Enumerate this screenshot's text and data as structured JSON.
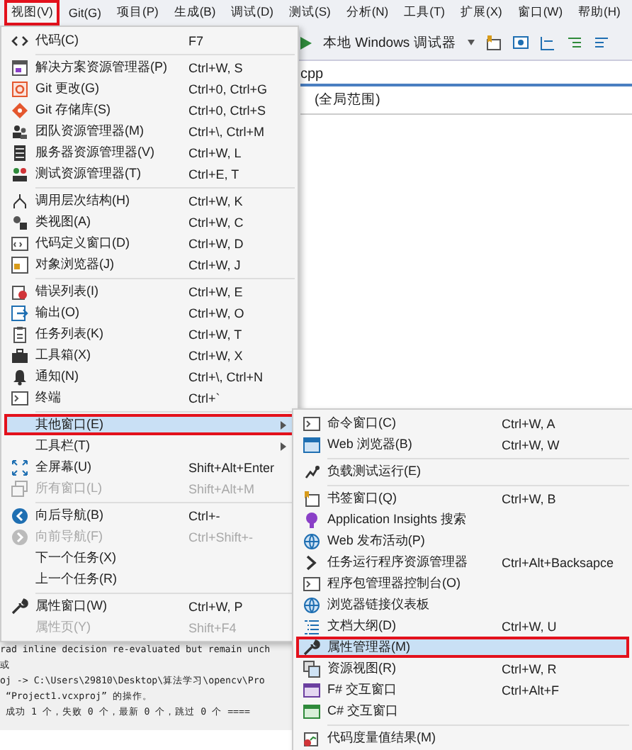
{
  "menu_bar": [
    {
      "label": "视图(V)",
      "selected": true
    },
    {
      "label": "Git(G)",
      "selected": false
    },
    {
      "label": "项目(P)",
      "selected": false
    },
    {
      "label": "生成(B)",
      "selected": false
    },
    {
      "label": "调试(D)",
      "selected": false
    },
    {
      "label": "测试(S)",
      "selected": false
    },
    {
      "label": "分析(N)",
      "selected": false
    },
    {
      "label": "工具(T)",
      "selected": false
    },
    {
      "label": "扩展(X)",
      "selected": false
    },
    {
      "label": "窗口(W)",
      "selected": false
    },
    {
      "label": "帮助(H)",
      "selected": false
    }
  ],
  "toolbar": {
    "debugger": "本地 Windows 调试器"
  },
  "editor": {
    "file_tab": "cpp",
    "scope": "(全局范围)"
  },
  "output": {
    "lines": [
      "rad inline decision re-evaluated but remain unch",
      "或",
      "oj -> C:\\Users\\29810\\Desktop\\算法学习\\opencv\\Pro",
      " “Project1.vcxproj” 的操作。",
      " 成功 1 个，失败 0 个，最新 0 个，跳过 0 个 ===="
    ]
  },
  "view_menu": {
    "groups": [
      [
        {
          "kind": "code",
          "label": "代码(C)",
          "shortcut": "F7",
          "disabled": false,
          "selected": false,
          "submenu": false
        }
      ],
      [
        {
          "kind": "solution",
          "label": "解决方案资源管理器(P)",
          "shortcut": "Ctrl+W, S",
          "disabled": false,
          "selected": false,
          "submenu": false
        },
        {
          "kind": "git-change",
          "label": "Git 更改(G)",
          "shortcut": "Ctrl+0, Ctrl+G",
          "disabled": false,
          "selected": false,
          "submenu": false
        },
        {
          "kind": "git-repo",
          "label": "Git 存储库(S)",
          "shortcut": "Ctrl+0, Ctrl+S",
          "disabled": false,
          "selected": false,
          "submenu": false
        },
        {
          "kind": "team",
          "label": "团队资源管理器(M)",
          "shortcut": "Ctrl+\\, Ctrl+M",
          "disabled": false,
          "selected": false,
          "submenu": false
        },
        {
          "kind": "server",
          "label": "服务器资源管理器(V)",
          "shortcut": "Ctrl+W, L",
          "disabled": false,
          "selected": false,
          "submenu": false
        },
        {
          "kind": "test",
          "label": "测试资源管理器(T)",
          "shortcut": "Ctrl+E, T",
          "disabled": false,
          "selected": false,
          "submenu": false
        }
      ],
      [
        {
          "kind": "hierarchy",
          "label": "调用层次结构(H)",
          "shortcut": "Ctrl+W, K",
          "disabled": false,
          "selected": false,
          "submenu": false
        },
        {
          "kind": "class",
          "label": "类视图(A)",
          "shortcut": "Ctrl+W, C",
          "disabled": false,
          "selected": false,
          "submenu": false
        },
        {
          "kind": "code-window",
          "label": "代码定义窗口(D)",
          "shortcut": "Ctrl+W, D",
          "disabled": false,
          "selected": false,
          "submenu": false
        },
        {
          "kind": "object-browser",
          "label": "对象浏览器(J)",
          "shortcut": "Ctrl+W, J",
          "disabled": false,
          "selected": false,
          "submenu": false
        }
      ],
      [
        {
          "kind": "error-list",
          "label": "错误列表(I)",
          "shortcut": "Ctrl+W, E",
          "disabled": false,
          "selected": false,
          "submenu": false
        },
        {
          "kind": "output",
          "label": "输出(O)",
          "shortcut": "Ctrl+W, O",
          "disabled": false,
          "selected": false,
          "submenu": false
        },
        {
          "kind": "task-list",
          "label": "任务列表(K)",
          "shortcut": "Ctrl+W, T",
          "disabled": false,
          "selected": false,
          "submenu": false
        },
        {
          "kind": "toolbox",
          "label": "工具箱(X)",
          "shortcut": "Ctrl+W, X",
          "disabled": false,
          "selected": false,
          "submenu": false
        },
        {
          "kind": "bell",
          "label": "通知(N)",
          "shortcut": "Ctrl+\\, Ctrl+N",
          "disabled": false,
          "selected": false,
          "submenu": false
        },
        {
          "kind": "terminal",
          "label": "终端",
          "shortcut": "Ctrl+`",
          "disabled": false,
          "selected": false,
          "submenu": false
        }
      ],
      [
        {
          "label": "其他窗口(E)",
          "disabled": false,
          "selected": true,
          "submenu": true
        },
        {
          "label": "工具栏(T)",
          "disabled": false,
          "selected": false,
          "submenu": true
        },
        {
          "kind": "fullscreen",
          "label": "全屏幕(U)",
          "shortcut": "Shift+Alt+Enter",
          "disabled": false,
          "selected": false,
          "submenu": false
        },
        {
          "kind": "windows",
          "label": "所有窗口(L)",
          "shortcut": "Shift+Alt+M",
          "disabled": true,
          "selected": false,
          "submenu": false
        }
      ],
      [
        {
          "kind": "back",
          "label": "向后导航(B)",
          "shortcut": "Ctrl+-",
          "disabled": false,
          "selected": false,
          "submenu": false
        },
        {
          "kind": "forward",
          "label": "向前导航(F)",
          "shortcut": "Ctrl+Shift+-",
          "disabled": true,
          "selected": false,
          "submenu": false
        },
        {
          "label": "下一个任务(X)",
          "disabled": false,
          "selected": false,
          "submenu": false
        },
        {
          "label": "上一个任务(R)",
          "disabled": false,
          "selected": false,
          "submenu": false
        }
      ],
      [
        {
          "kind": "wrench",
          "label": "属性窗口(W)",
          "shortcut": "Ctrl+W, P",
          "disabled": false,
          "selected": false,
          "submenu": false
        },
        {
          "label": "属性页(Y)",
          "shortcut": "Shift+F4",
          "disabled": true,
          "selected": false,
          "submenu": false
        }
      ]
    ]
  },
  "other_windows_menu": {
    "groups": [
      [
        {
          "kind": "terminal",
          "label": "命令窗口(C)",
          "shortcut": "Ctrl+W, A",
          "selected": false
        },
        {
          "kind": "browser",
          "label": "Web 浏览器(B)",
          "shortcut": "Ctrl+W, W",
          "selected": false
        }
      ],
      [
        {
          "kind": "load",
          "label": "负载测试运行(E)",
          "selected": false
        }
      ],
      [
        {
          "kind": "bookmark",
          "label": "书签窗口(Q)",
          "shortcut": "Ctrl+W, B",
          "selected": false
        },
        {
          "kind": "bulb",
          "label": "Application Insights 搜索",
          "selected": false
        },
        {
          "kind": "globe",
          "label": "Web 发布活动(P)",
          "selected": false
        },
        {
          "kind": "chevron",
          "label": "任务运行程序资源管理器",
          "shortcut": "Ctrl+Alt+Backsapce",
          "selected": false
        },
        {
          "kind": "terminal",
          "label": "程序包管理器控制台(O)",
          "selected": false
        },
        {
          "kind": "globe",
          "label": "浏览器链接仪表板",
          "selected": false
        },
        {
          "kind": "outline",
          "label": "文档大纲(D)",
          "shortcut": "Ctrl+W, U",
          "selected": false
        },
        {
          "kind": "wrench",
          "label": "属性管理器(M)",
          "selected": true
        },
        {
          "kind": "resource",
          "label": "资源视图(R)",
          "shortcut": "Ctrl+W, R",
          "selected": false
        },
        {
          "kind": "fsharp",
          "label": "F# 交互窗口",
          "shortcut": "Ctrl+Alt+F",
          "selected": false
        },
        {
          "kind": "csharp",
          "label": "C# 交互窗口",
          "selected": false
        }
      ],
      [
        {
          "kind": "metrics",
          "label": "代码度量值结果(M)",
          "selected": false
        }
      ]
    ]
  }
}
